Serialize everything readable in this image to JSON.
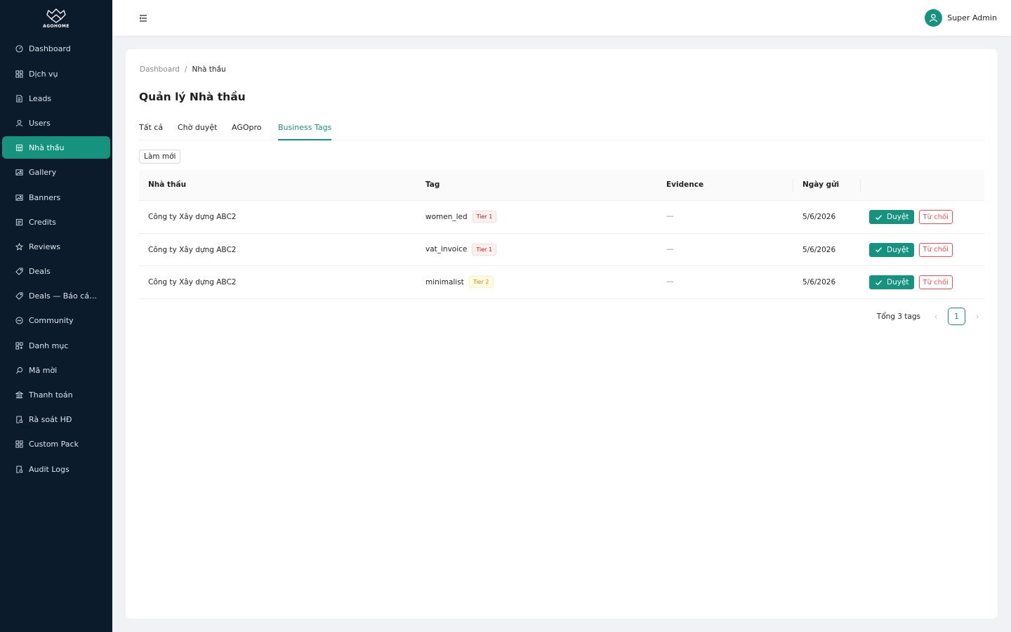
{
  "app": {
    "logo_text": "AGOHOME"
  },
  "sidebar": {
    "items": [
      {
        "label": "Dashboard",
        "icon": "dashboard-icon"
      },
      {
        "label": "Dịch vụ",
        "icon": "grid-icon"
      },
      {
        "label": "Leads",
        "icon": "file-icon"
      },
      {
        "label": "Users",
        "icon": "user-icon"
      },
      {
        "label": "Nhà thầu",
        "icon": "building-icon",
        "active": true
      },
      {
        "label": "Gallery",
        "icon": "image-icon"
      },
      {
        "label": "Banners",
        "icon": "image-icon"
      },
      {
        "label": "Credits",
        "icon": "file-text-icon"
      },
      {
        "label": "Reviews",
        "icon": "star-icon"
      },
      {
        "label": "Deals",
        "icon": "tag-icon"
      },
      {
        "label": "Deals — Báo cáo ...",
        "icon": "tag-icon"
      },
      {
        "label": "Community",
        "icon": "message-icon"
      },
      {
        "label": "Danh mục",
        "icon": "apps-icon"
      },
      {
        "label": "Mã mời",
        "icon": "search-icon"
      },
      {
        "label": "Thanh toán",
        "icon": "bank-icon"
      },
      {
        "label": "Rà soát HĐ",
        "icon": "audit-icon"
      },
      {
        "label": "Custom Pack",
        "icon": "apps-icon"
      },
      {
        "label": "Audit Logs",
        "icon": "audit-icon"
      }
    ]
  },
  "header": {
    "user_name": "Super Admin"
  },
  "breadcrumb": {
    "root": "Dashboard",
    "separator": "/",
    "current": "Nhà thầu"
  },
  "page": {
    "title": "Quản lý Nhà thầu"
  },
  "tabs": [
    {
      "label": "Tất cả"
    },
    {
      "label": "Chờ duyệt"
    },
    {
      "label": "AGOpro"
    },
    {
      "label": "Business Tags",
      "active": true
    }
  ],
  "toolbar": {
    "refresh_label": "Làm mới"
  },
  "table": {
    "columns": [
      "Nhà thầu",
      "Tag",
      "Evidence",
      "Ngày gửi"
    ],
    "rows": [
      {
        "contractor": "Công ty Xây dựng ABC2",
        "tag": "women_led",
        "tier": "Tier 1",
        "tier_color": "red",
        "evidence": "—",
        "date": "5/6/2026",
        "approve": "Duyệt",
        "reject": "Từ chối"
      },
      {
        "contractor": "Công ty Xây dựng ABC2",
        "tag": "vat_invoice",
        "tier": "Tier 1",
        "tier_color": "red",
        "evidence": "—",
        "date": "5/6/2026",
        "approve": "Duyệt",
        "reject": "Từ chối"
      },
      {
        "contractor": "Công ty Xây dựng ABC2",
        "tag": "minimalist",
        "tier": "Tier 2",
        "tier_color": "gold",
        "evidence": "—",
        "date": "5/6/2026",
        "approve": "Duyệt",
        "reject": "Từ chối"
      }
    ]
  },
  "pagination": {
    "total_text": "Tổng 3 tags",
    "current_page": "1",
    "prev": "‹",
    "next": "›"
  },
  "colors": {
    "accent": "#15937f",
    "sidebar_bg": "#0b1b2b",
    "reject": "#ff4d4f"
  }
}
